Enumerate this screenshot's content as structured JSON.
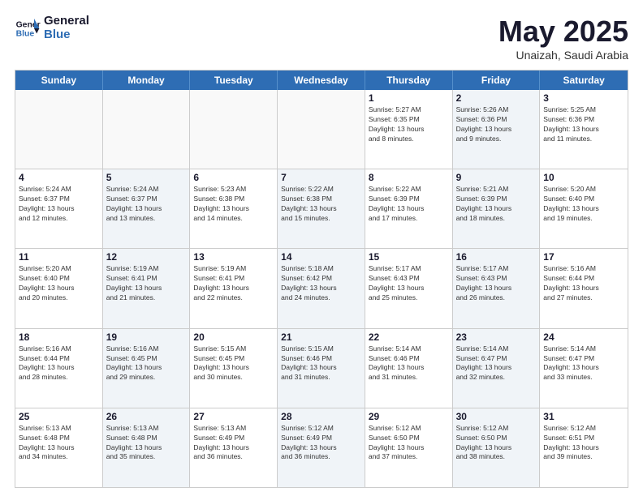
{
  "header": {
    "logo_general": "General",
    "logo_blue": "Blue",
    "month": "May 2025",
    "location": "Unaizah, Saudi Arabia"
  },
  "weekdays": [
    "Sunday",
    "Monday",
    "Tuesday",
    "Wednesday",
    "Thursday",
    "Friday",
    "Saturday"
  ],
  "rows": [
    [
      {
        "day": "",
        "info": "",
        "shaded": false,
        "empty": true
      },
      {
        "day": "",
        "info": "",
        "shaded": false,
        "empty": true
      },
      {
        "day": "",
        "info": "",
        "shaded": false,
        "empty": true
      },
      {
        "day": "",
        "info": "",
        "shaded": false,
        "empty": true
      },
      {
        "day": "1",
        "info": "Sunrise: 5:27 AM\nSunset: 6:35 PM\nDaylight: 13 hours\nand 8 minutes.",
        "shaded": false,
        "empty": false
      },
      {
        "day": "2",
        "info": "Sunrise: 5:26 AM\nSunset: 6:36 PM\nDaylight: 13 hours\nand 9 minutes.",
        "shaded": true,
        "empty": false
      },
      {
        "day": "3",
        "info": "Sunrise: 5:25 AM\nSunset: 6:36 PM\nDaylight: 13 hours\nand 11 minutes.",
        "shaded": false,
        "empty": false
      }
    ],
    [
      {
        "day": "4",
        "info": "Sunrise: 5:24 AM\nSunset: 6:37 PM\nDaylight: 13 hours\nand 12 minutes.",
        "shaded": false,
        "empty": false
      },
      {
        "day": "5",
        "info": "Sunrise: 5:24 AM\nSunset: 6:37 PM\nDaylight: 13 hours\nand 13 minutes.",
        "shaded": true,
        "empty": false
      },
      {
        "day": "6",
        "info": "Sunrise: 5:23 AM\nSunset: 6:38 PM\nDaylight: 13 hours\nand 14 minutes.",
        "shaded": false,
        "empty": false
      },
      {
        "day": "7",
        "info": "Sunrise: 5:22 AM\nSunset: 6:38 PM\nDaylight: 13 hours\nand 15 minutes.",
        "shaded": true,
        "empty": false
      },
      {
        "day": "8",
        "info": "Sunrise: 5:22 AM\nSunset: 6:39 PM\nDaylight: 13 hours\nand 17 minutes.",
        "shaded": false,
        "empty": false
      },
      {
        "day": "9",
        "info": "Sunrise: 5:21 AM\nSunset: 6:39 PM\nDaylight: 13 hours\nand 18 minutes.",
        "shaded": true,
        "empty": false
      },
      {
        "day": "10",
        "info": "Sunrise: 5:20 AM\nSunset: 6:40 PM\nDaylight: 13 hours\nand 19 minutes.",
        "shaded": false,
        "empty": false
      }
    ],
    [
      {
        "day": "11",
        "info": "Sunrise: 5:20 AM\nSunset: 6:40 PM\nDaylight: 13 hours\nand 20 minutes.",
        "shaded": false,
        "empty": false
      },
      {
        "day": "12",
        "info": "Sunrise: 5:19 AM\nSunset: 6:41 PM\nDaylight: 13 hours\nand 21 minutes.",
        "shaded": true,
        "empty": false
      },
      {
        "day": "13",
        "info": "Sunrise: 5:19 AM\nSunset: 6:41 PM\nDaylight: 13 hours\nand 22 minutes.",
        "shaded": false,
        "empty": false
      },
      {
        "day": "14",
        "info": "Sunrise: 5:18 AM\nSunset: 6:42 PM\nDaylight: 13 hours\nand 24 minutes.",
        "shaded": true,
        "empty": false
      },
      {
        "day": "15",
        "info": "Sunrise: 5:17 AM\nSunset: 6:43 PM\nDaylight: 13 hours\nand 25 minutes.",
        "shaded": false,
        "empty": false
      },
      {
        "day": "16",
        "info": "Sunrise: 5:17 AM\nSunset: 6:43 PM\nDaylight: 13 hours\nand 26 minutes.",
        "shaded": true,
        "empty": false
      },
      {
        "day": "17",
        "info": "Sunrise: 5:16 AM\nSunset: 6:44 PM\nDaylight: 13 hours\nand 27 minutes.",
        "shaded": false,
        "empty": false
      }
    ],
    [
      {
        "day": "18",
        "info": "Sunrise: 5:16 AM\nSunset: 6:44 PM\nDaylight: 13 hours\nand 28 minutes.",
        "shaded": false,
        "empty": false
      },
      {
        "day": "19",
        "info": "Sunrise: 5:16 AM\nSunset: 6:45 PM\nDaylight: 13 hours\nand 29 minutes.",
        "shaded": true,
        "empty": false
      },
      {
        "day": "20",
        "info": "Sunrise: 5:15 AM\nSunset: 6:45 PM\nDaylight: 13 hours\nand 30 minutes.",
        "shaded": false,
        "empty": false
      },
      {
        "day": "21",
        "info": "Sunrise: 5:15 AM\nSunset: 6:46 PM\nDaylight: 13 hours\nand 31 minutes.",
        "shaded": true,
        "empty": false
      },
      {
        "day": "22",
        "info": "Sunrise: 5:14 AM\nSunset: 6:46 PM\nDaylight: 13 hours\nand 31 minutes.",
        "shaded": false,
        "empty": false
      },
      {
        "day": "23",
        "info": "Sunrise: 5:14 AM\nSunset: 6:47 PM\nDaylight: 13 hours\nand 32 minutes.",
        "shaded": true,
        "empty": false
      },
      {
        "day": "24",
        "info": "Sunrise: 5:14 AM\nSunset: 6:47 PM\nDaylight: 13 hours\nand 33 minutes.",
        "shaded": false,
        "empty": false
      }
    ],
    [
      {
        "day": "25",
        "info": "Sunrise: 5:13 AM\nSunset: 6:48 PM\nDaylight: 13 hours\nand 34 minutes.",
        "shaded": false,
        "empty": false
      },
      {
        "day": "26",
        "info": "Sunrise: 5:13 AM\nSunset: 6:48 PM\nDaylight: 13 hours\nand 35 minutes.",
        "shaded": true,
        "empty": false
      },
      {
        "day": "27",
        "info": "Sunrise: 5:13 AM\nSunset: 6:49 PM\nDaylight: 13 hours\nand 36 minutes.",
        "shaded": false,
        "empty": false
      },
      {
        "day": "28",
        "info": "Sunrise: 5:12 AM\nSunset: 6:49 PM\nDaylight: 13 hours\nand 36 minutes.",
        "shaded": true,
        "empty": false
      },
      {
        "day": "29",
        "info": "Sunrise: 5:12 AM\nSunset: 6:50 PM\nDaylight: 13 hours\nand 37 minutes.",
        "shaded": false,
        "empty": false
      },
      {
        "day": "30",
        "info": "Sunrise: 5:12 AM\nSunset: 6:50 PM\nDaylight: 13 hours\nand 38 minutes.",
        "shaded": true,
        "empty": false
      },
      {
        "day": "31",
        "info": "Sunrise: 5:12 AM\nSunset: 6:51 PM\nDaylight: 13 hours\nand 39 minutes.",
        "shaded": false,
        "empty": false
      }
    ]
  ]
}
